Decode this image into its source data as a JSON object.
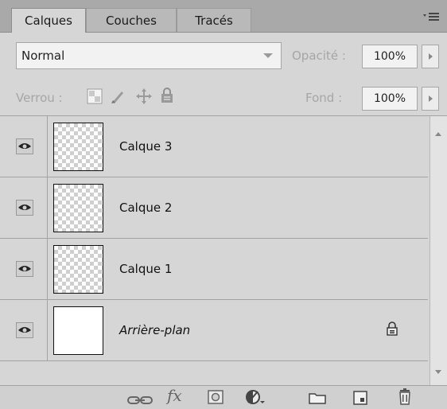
{
  "tabs": [
    {
      "label": "Calques",
      "active": true
    },
    {
      "label": "Couches",
      "active": false
    },
    {
      "label": "Tracés",
      "active": false
    }
  ],
  "panel_menu_icon": "panel-menu-icon",
  "blend": {
    "value": "Normal"
  },
  "opacity": {
    "label": "Opacité :",
    "value": "100%"
  },
  "lock": {
    "label": "Verrou :"
  },
  "fill": {
    "label": "Fond :",
    "value": "100%"
  },
  "layers": [
    {
      "name": "Calque 3",
      "visible": true,
      "transparent_thumb": true,
      "locked": false
    },
    {
      "name": "Calque 2",
      "visible": true,
      "transparent_thumb": true,
      "locked": false
    },
    {
      "name": "Calque 1",
      "visible": true,
      "transparent_thumb": true,
      "locked": false
    },
    {
      "name": "Arrière-plan",
      "visible": true,
      "transparent_thumb": false,
      "locked": true,
      "italic": true
    }
  ],
  "bottom_toolbar": {
    "icons": [
      "link-layers-icon",
      "fx-icon",
      "add-mask-icon",
      "adjustment-layer-icon",
      "new-group-icon",
      "new-layer-icon",
      "delete-layer-icon"
    ],
    "fx_label": "fx"
  },
  "colors": {
    "panel_bg": "#d6d6d6",
    "tabbar_bg": "#a9a9a9",
    "border": "#a3a3a3",
    "disabled_text": "#a6a6a6"
  }
}
